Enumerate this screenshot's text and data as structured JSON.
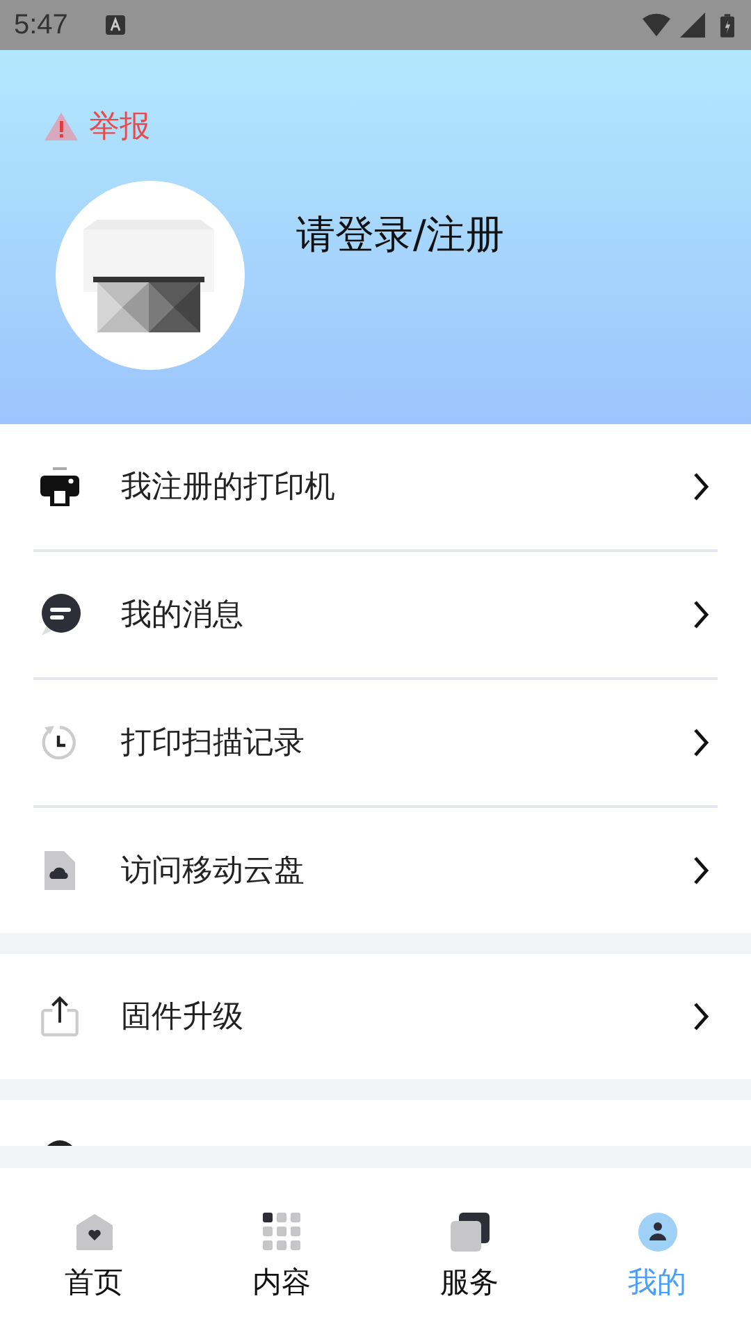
{
  "status_bar": {
    "time": "5:47"
  },
  "header": {
    "report": "举报",
    "login": "请登录/注册"
  },
  "menu_groups": [
    {
      "items": [
        {
          "label": "我注册的打印机",
          "kind": "printer"
        },
        {
          "label": "我的消息",
          "kind": "message"
        },
        {
          "label": "打印扫描记录",
          "kind": "history"
        },
        {
          "label": "访问移动云盘",
          "kind": "cloud"
        }
      ]
    },
    {
      "items": [
        {
          "label": "固件升级",
          "kind": "upgrade"
        }
      ]
    }
  ],
  "tab_bar": [
    {
      "label": "首页",
      "kind": "home",
      "selected": false
    },
    {
      "label": "内容",
      "kind": "grid",
      "selected": false
    },
    {
      "label": "服务",
      "kind": "service",
      "selected": false
    },
    {
      "label": "我的",
      "kind": "person",
      "selected": true
    }
  ]
}
